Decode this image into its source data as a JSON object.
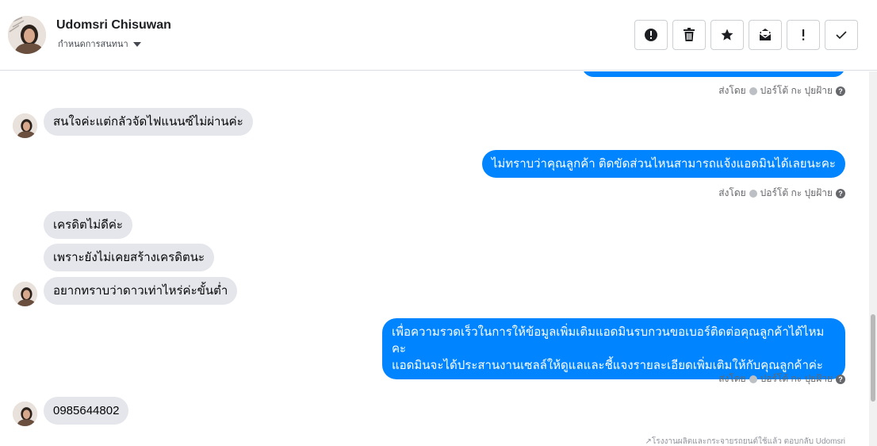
{
  "header": {
    "contact_name": "Udomsri Chisuwan",
    "subtitle": "กำหนดการสนทนา",
    "actions": [
      {
        "icon": "exclamation-circle-icon",
        "label": "report"
      },
      {
        "icon": "trash-icon",
        "label": "delete"
      },
      {
        "icon": "star-icon",
        "label": "star"
      },
      {
        "icon": "mail-icon",
        "label": "mark-unread"
      },
      {
        "icon": "exclamation-icon",
        "label": "spam"
      },
      {
        "icon": "check-icon",
        "label": "done"
      }
    ]
  },
  "messages": [
    {
      "dir": "out",
      "text": ""
    },
    {
      "dir": "in",
      "text": "สนใจค่ะแต่กลัวจัดไฟแนนซ์ไม่ผ่านค่ะ"
    },
    {
      "dir": "out",
      "text": "ไม่ทราบว่าคุณลูกค้า ติดขัดส่วนไหนสามารถแจ้งแอดมินได้เลยนะคะ"
    },
    {
      "dir": "in",
      "text": "เครดิตไม่ดีค่ะ"
    },
    {
      "dir": "in",
      "text": "เพราะยังไม่เคยสร้างเครดิตนะ"
    },
    {
      "dir": "in",
      "text": "อยากทราบว่าดาวเท่าไหร่ค่ะขั้นต่ำ"
    },
    {
      "dir": "out",
      "text_line1": "เพื่อความรวดเร็วในการให้ข้อมูลเพิ่มเติมแอดมินรบกวนขอเบอร์ติดต่อคุณลูกค้าได้ไหมคะ",
      "text_line2": "แอดมินจะได้ประสานงานเซลล์ให้ดูแลและชี้แจงรายละเอียดเพิ่มเติมให้กับคุณลูกค้าค่ะ"
    },
    {
      "dir": "in",
      "text": "0985644802"
    }
  ],
  "sent_by": {
    "prefix": "ส่งโดย",
    "name": "ปอร์โต้ กะ ปุยฝ้าย",
    "help": "?"
  },
  "footer_note": "โรงงานผลิตและกระจายรถยนต์ใช้แล้ว ตอบกลับ Udomsri",
  "colors": {
    "outgoing": "#0084ff",
    "incoming": "#e4e6eb"
  }
}
